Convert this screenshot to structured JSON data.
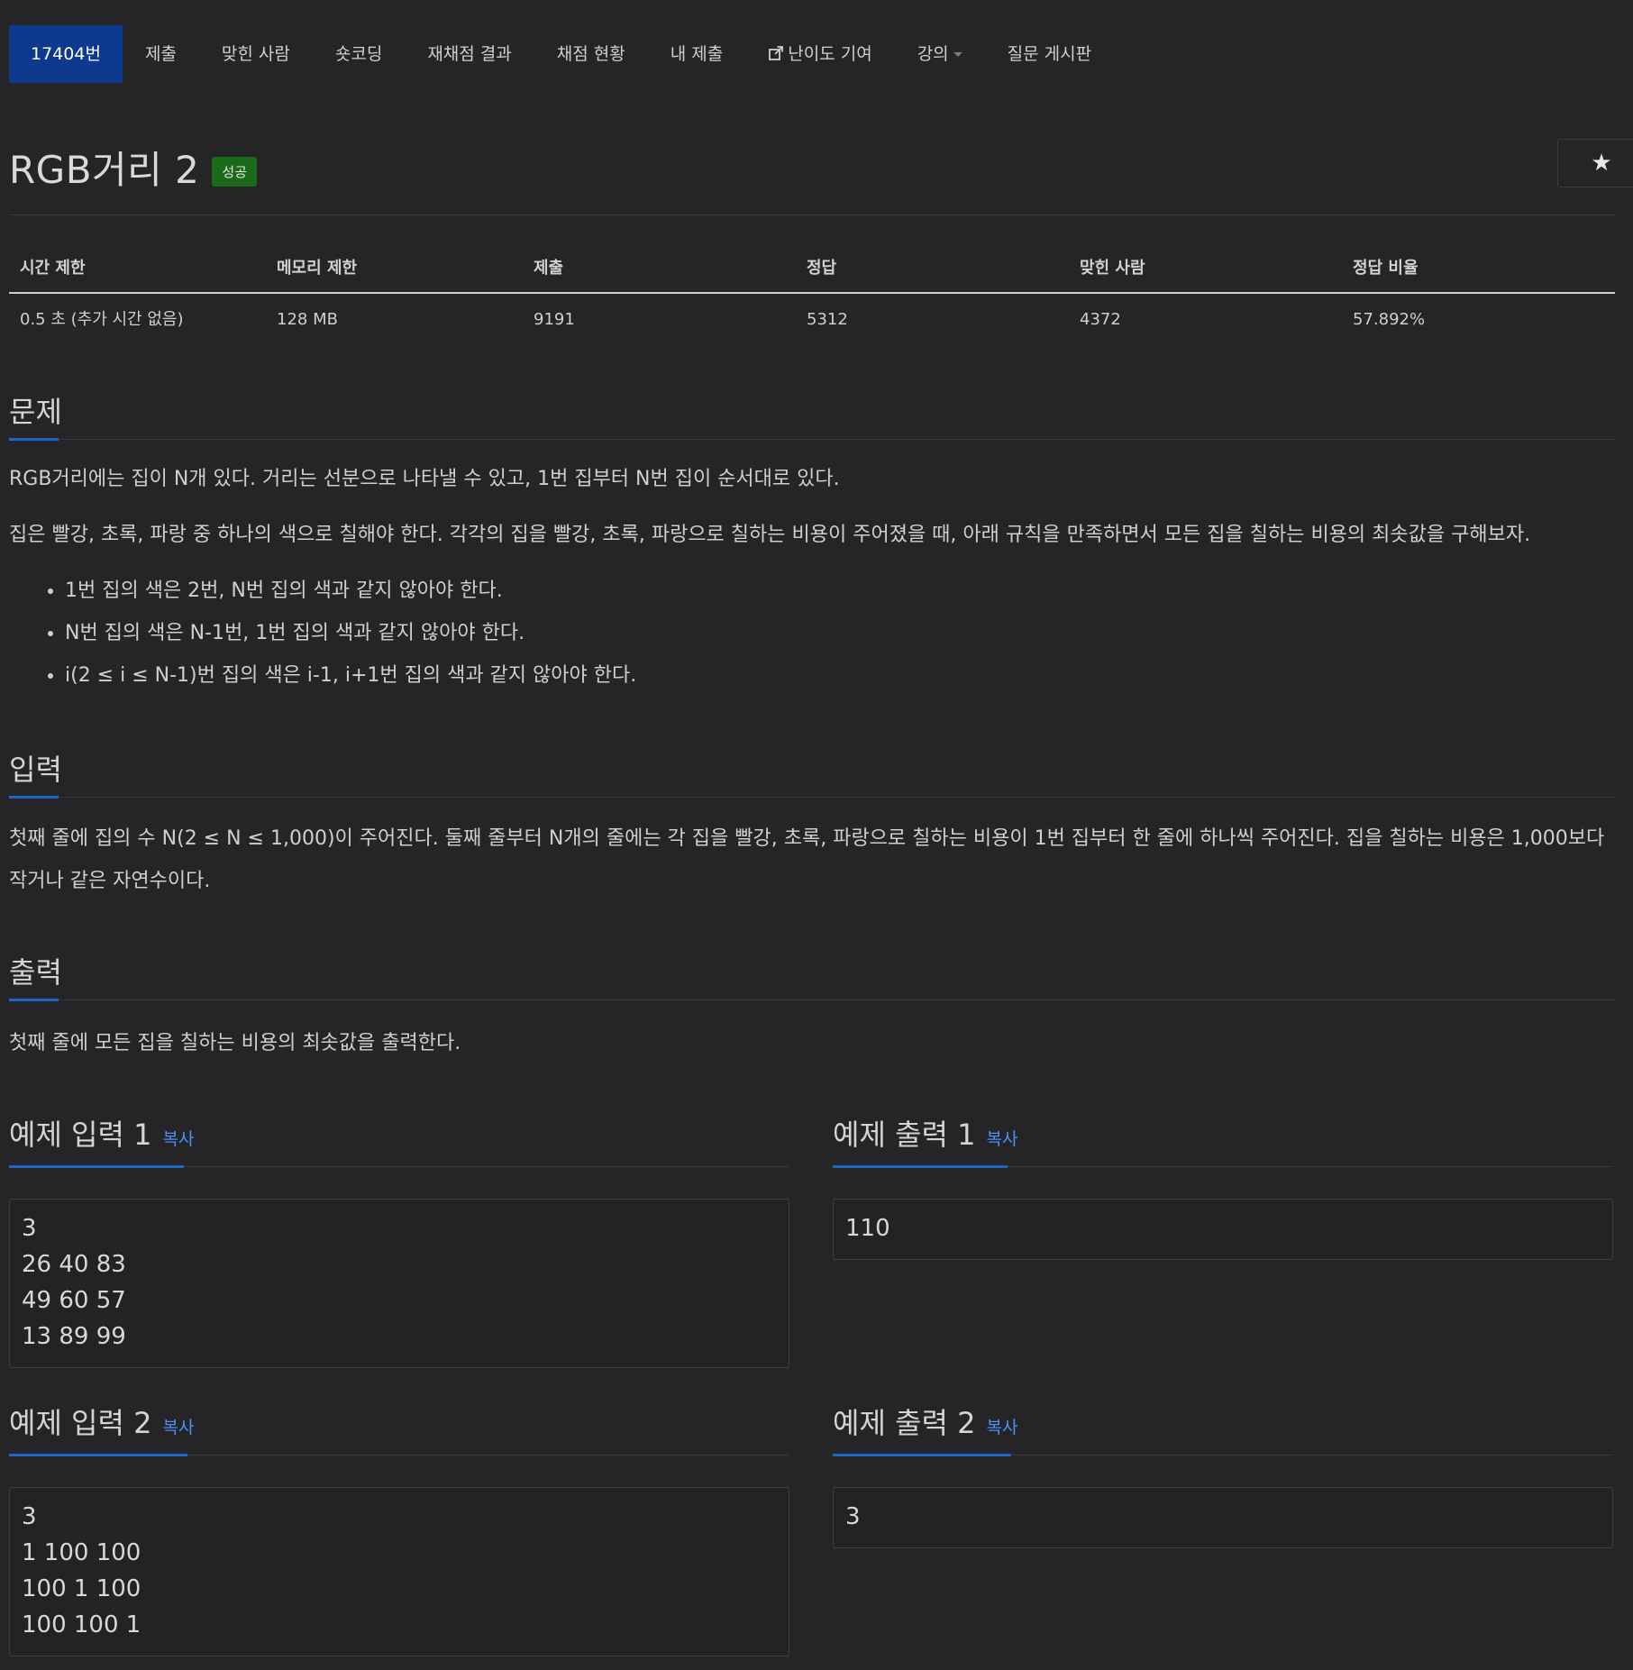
{
  "nav": {
    "items": [
      {
        "label": "17404번",
        "active": true
      },
      {
        "label": "제출"
      },
      {
        "label": "맞힌 사람"
      },
      {
        "label": "숏코딩"
      },
      {
        "label": "재채점 결과"
      },
      {
        "label": "채점 현황"
      },
      {
        "label": "내 제출"
      },
      {
        "label": "난이도 기여",
        "icon": "external-link-icon"
      },
      {
        "label": "강의",
        "icon": "caret-down-icon"
      },
      {
        "label": "질문 게시판"
      }
    ]
  },
  "problem": {
    "title": "RGB거리 2",
    "badge": "성공",
    "star_icon": "★"
  },
  "stats": {
    "headers": [
      "시간 제한",
      "메모리 제한",
      "제출",
      "정답",
      "맞힌 사람",
      "정답 비율"
    ],
    "values": [
      "0.5 초 (추가 시간 없음)",
      "128 MB",
      "9191",
      "5312",
      "4372",
      "57.892%"
    ]
  },
  "sections": {
    "problem_heading": "문제",
    "problem_p1": "RGB거리에는 집이 N개 있다. 거리는 선분으로 나타낼 수 있고, 1번 집부터 N번 집이 순서대로 있다.",
    "problem_p2": "집은 빨강, 초록, 파랑 중 하나의 색으로 칠해야 한다. 각각의 집을 빨강, 초록, 파랑으로 칠하는 비용이 주어졌을 때, 아래 규칙을 만족하면서 모든 집을 칠하는 비용의 최솟값을 구해보자.",
    "rules": [
      "1번 집의 색은 2번, N번 집의 색과 같지 않아야 한다.",
      "N번 집의 색은 N-1번, 1번 집의 색과 같지 않아야 한다.",
      "i(2 ≤ i ≤ N-1)번 집의 색은 i-1, i+1번 집의 색과 같지 않아야 한다."
    ],
    "input_heading": "입력",
    "input_text": "첫째 줄에 집의 수 N(2 ≤ N ≤ 1,000)이 주어진다. 둘째 줄부터 N개의 줄에는 각 집을 빨강, 초록, 파랑으로 칠하는 비용이 1번 집부터 한 줄에 하나씩 주어진다. 집을 칠하는 비용은 1,000보다 작거나 같은 자연수이다.",
    "output_heading": "출력",
    "output_text": "첫째 줄에 모든 집을 칠하는 비용의 최솟값을 출력한다."
  },
  "examples": {
    "copy_label": "복사",
    "in1_title": "예제 입력 1",
    "in1_lines": [
      "3",
      "26 40 83",
      "49 60 57",
      "13 89 99"
    ],
    "out1_title": "예제 출력 1",
    "out1_lines": [
      "110"
    ],
    "in2_title": "예제 입력 2",
    "in2_lines": [
      "3",
      "1 100 100",
      "100 1 100",
      "100 100 1"
    ],
    "out2_title": "예제 출력 2",
    "out2_lines": [
      "3"
    ]
  },
  "colors": {
    "background": "#252527",
    "nav_active": "#0d3a8e",
    "badge_success": "#1a6a1a",
    "accent_underline": "#1f63c3",
    "copy_link": "#4c8ef2"
  }
}
